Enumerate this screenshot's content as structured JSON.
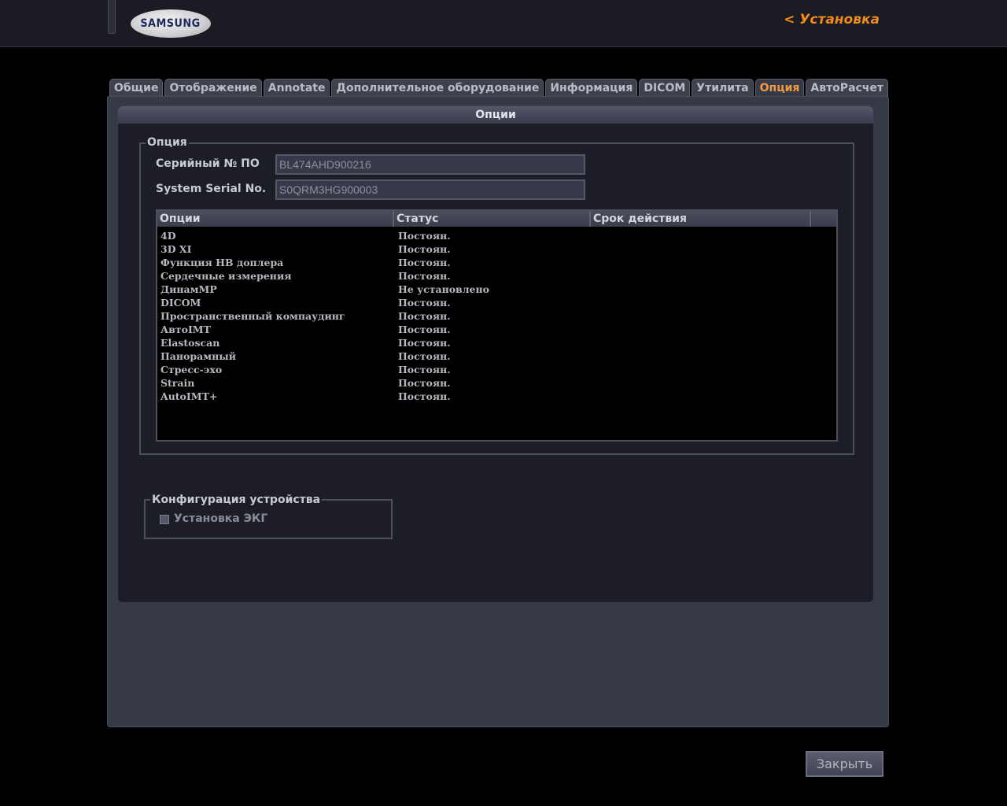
{
  "header": {
    "logo_text": "SAMSUNG",
    "title": "< Установка"
  },
  "tabs": [
    {
      "label": "Общие",
      "active": false
    },
    {
      "label": "Отображение",
      "active": false
    },
    {
      "label": "Annotate",
      "active": false
    },
    {
      "label": "Дополнительное оборудование",
      "active": false
    },
    {
      "label": "Информация",
      "active": false
    },
    {
      "label": "DICOM",
      "active": false
    },
    {
      "label": "Утилита",
      "active": false
    },
    {
      "label": "Опция",
      "active": true
    },
    {
      "label": "АвтоРасчет",
      "active": false
    }
  ],
  "panel": {
    "title": "Опции"
  },
  "option_group": {
    "legend": "Опция",
    "sw_serial_label": "Серийный № ПО",
    "sw_serial_value": "BL474AHD900216",
    "system_serial_label": "System Serial No.",
    "system_serial_value": "S0QRM3HG900003"
  },
  "options_table": {
    "columns": [
      "Опции",
      "Статус",
      "Срок действия"
    ],
    "rows": [
      {
        "option": "4D",
        "status": "Постоян.",
        "expiry": ""
      },
      {
        "option": "3D XI",
        "status": "Постоян.",
        "expiry": ""
      },
      {
        "option": "Функция НВ доплера",
        "status": "Постоян.",
        "expiry": ""
      },
      {
        "option": "Сердечные измерения",
        "status": "Постоян.",
        "expiry": ""
      },
      {
        "option": "ДинамМР",
        "status": "Не установлено",
        "expiry": ""
      },
      {
        "option": "DICOM",
        "status": "Постоян.",
        "expiry": ""
      },
      {
        "option": "Пространственный компаудинг",
        "status": "Постоян.",
        "expiry": ""
      },
      {
        "option": "АвтоIMT",
        "status": "Постоян.",
        "expiry": ""
      },
      {
        "option": "Elastoscan",
        "status": "Постоян.",
        "expiry": ""
      },
      {
        "option": "Панорамный",
        "status": "Постоян.",
        "expiry": ""
      },
      {
        "option": "Стресс-эхо",
        "status": "Постоян.",
        "expiry": ""
      },
      {
        "option": "Strain",
        "status": "Постоян.",
        "expiry": ""
      },
      {
        "option": "AutoIMT+",
        "status": "Постоян.",
        "expiry": ""
      }
    ]
  },
  "device_config": {
    "legend": "Конфигурация устройства",
    "ecg_label": "Установка ЭКГ",
    "ecg_checked": false
  },
  "footer": {
    "close_label": "Закрыть"
  },
  "colors": {
    "accent": "#f08a1c",
    "active_tab": "#f09a42",
    "panel_bg": "#363946"
  }
}
